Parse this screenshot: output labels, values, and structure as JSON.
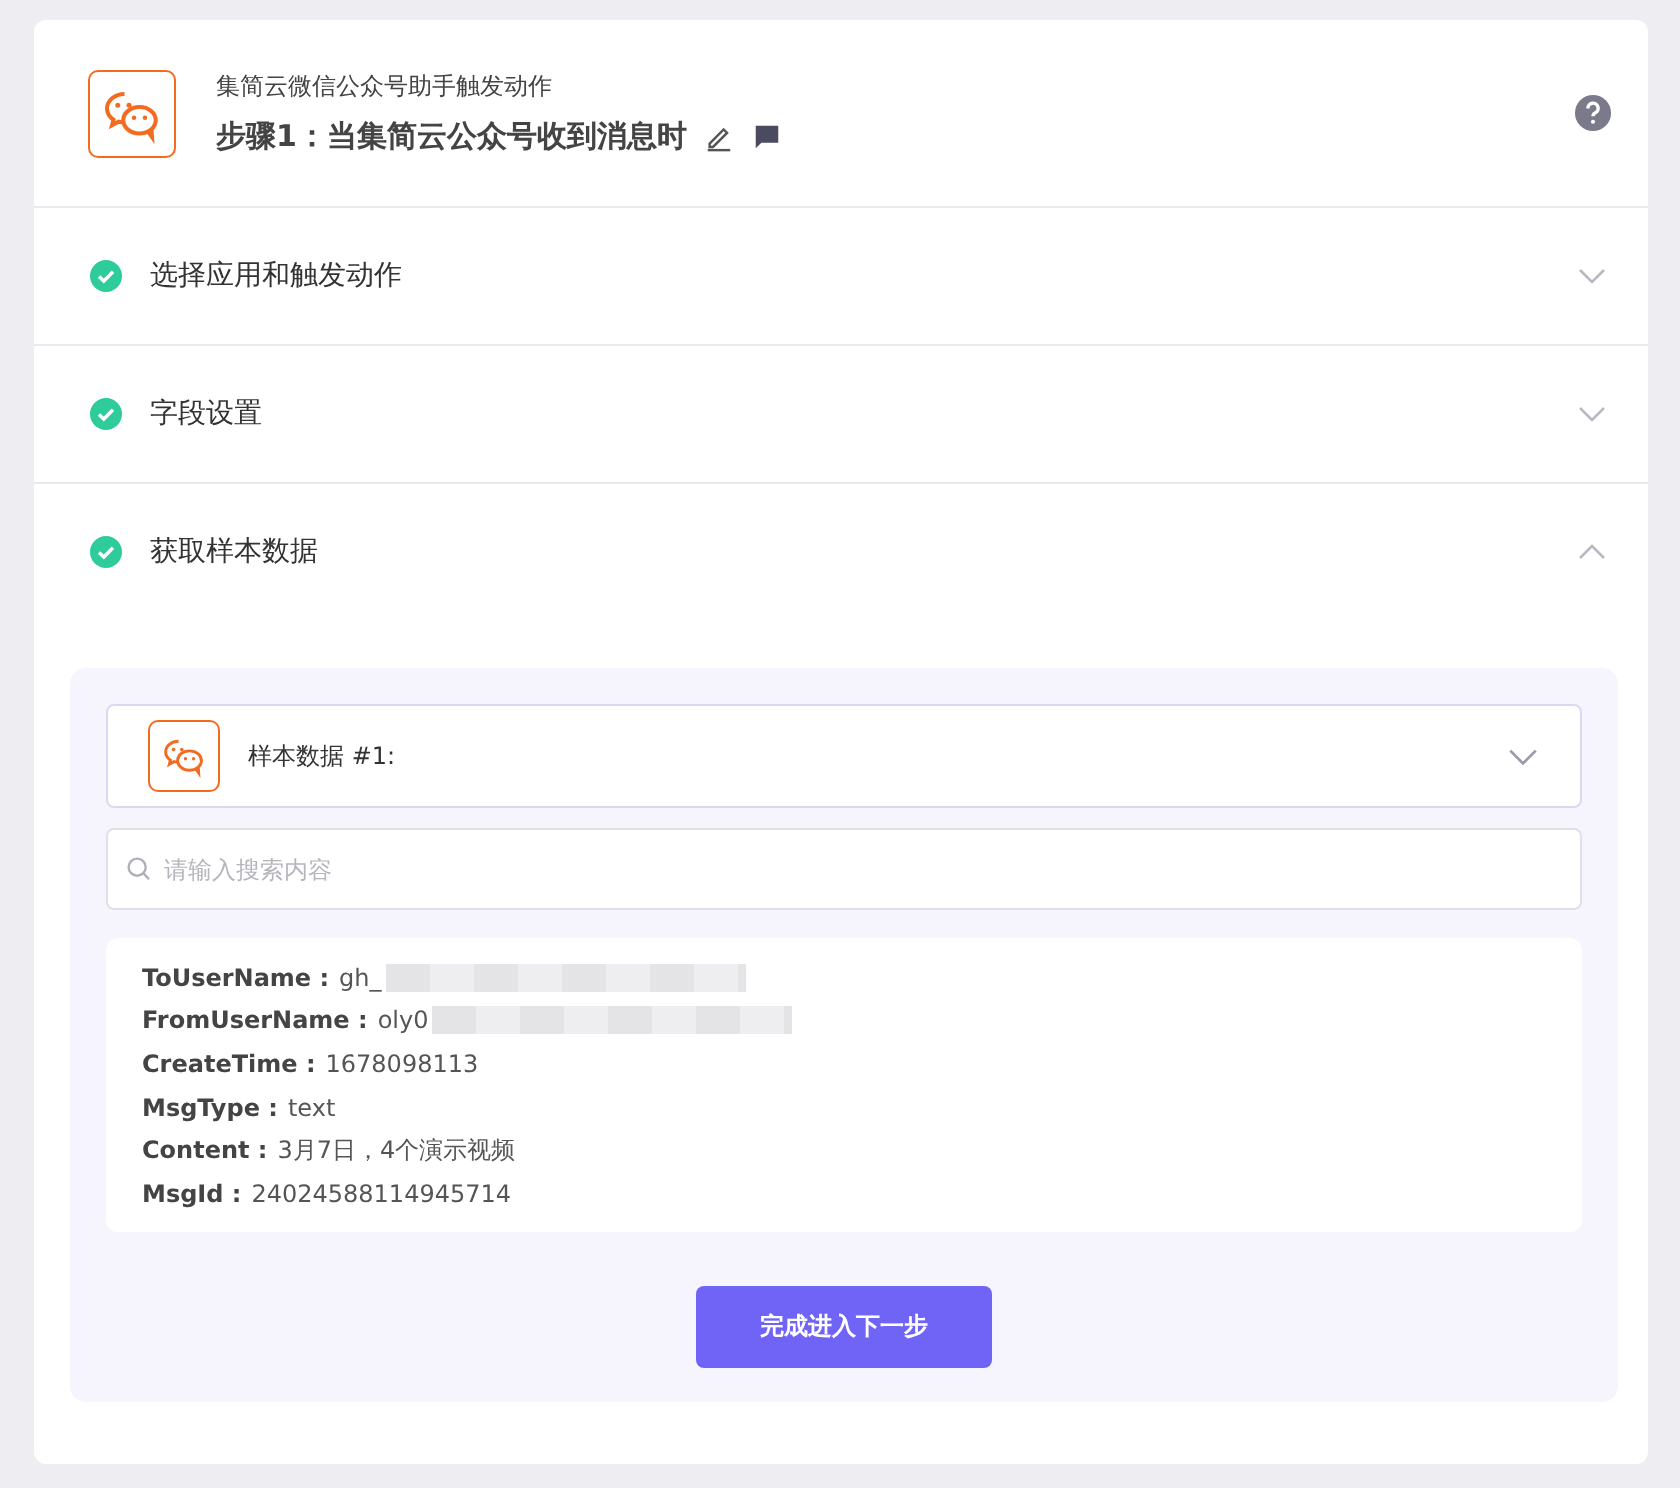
{
  "header": {
    "app_name": "集简云微信公众号助手触发动作",
    "step_title": "步骤1：当集简云公众号收到消息时"
  },
  "sections": [
    {
      "title": "选择应用和触发动作",
      "done": true,
      "expanded": false
    },
    {
      "title": "字段设置",
      "done": true,
      "expanded": false
    },
    {
      "title": "获取样本数据",
      "done": true,
      "expanded": true
    }
  ],
  "sample": {
    "label": "样本数据 #1:",
    "expanded": false
  },
  "search": {
    "placeholder": "请输入搜索内容"
  },
  "fields": [
    {
      "key": "ToUserName :",
      "value": "gh_",
      "redacted": true
    },
    {
      "key": "FromUserName :",
      "value": "oly0",
      "redacted": true
    },
    {
      "key": "CreateTime :",
      "value": "1678098113",
      "redacted": false
    },
    {
      "key": "MsgType :",
      "value": "text",
      "redacted": false
    },
    {
      "key": "Content :",
      "value": "3月7日，4个演示视频",
      "redacted": false
    },
    {
      "key": "MsgId :",
      "value": "24024588114945714",
      "redacted": false
    }
  ],
  "next_button": "完成进入下一步"
}
